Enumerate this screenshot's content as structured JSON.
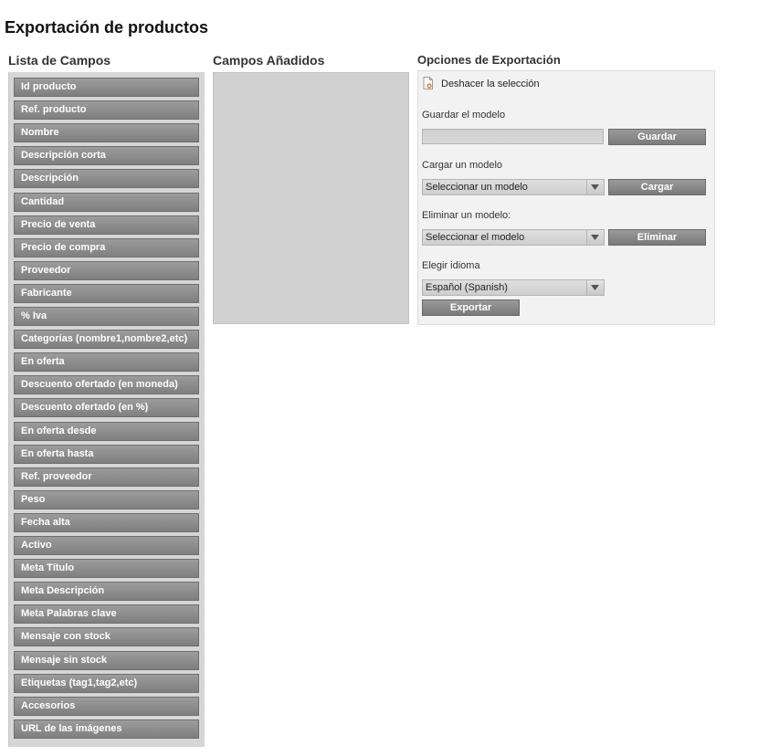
{
  "page": {
    "title": "Exportación de productos"
  },
  "fields": {
    "title": "Lista de Campos",
    "items": [
      "Id producto",
      "Ref. producto",
      "Nombre",
      "Descripción corta",
      "Descripción",
      "Cantidad",
      "Precio de venta",
      "Precio de compra",
      "Proveedor",
      "Fabricante",
      "% Iva",
      "Categorías (nombre1,nombre2,etc)",
      "En oferta",
      "Descuento ofertado (en moneda)",
      "Descuento ofertado (en %)",
      "En oferta desde",
      "En oferta hasta",
      "Ref. proveedor",
      "Peso",
      "Fecha alta",
      "Activo",
      "Meta Título",
      "Meta Descripción",
      "Meta Palabras clave",
      "Mensaje con stock",
      "Mensaje sin stock",
      "Etiquetas (tag1,tag2,etc)",
      "Accesorios",
      "URL de las imágenes"
    ]
  },
  "added": {
    "title": "Campos Añadidos"
  },
  "options": {
    "title": "Opciones de Exportación",
    "undo_label": "Deshacer la selección",
    "save_label": "Guardar el modelo",
    "save_input_value": "",
    "save_button": "Guardar",
    "load_label": "Cargar un modelo",
    "load_select": "Seleccionar un modelo",
    "load_button": "Cargar",
    "delete_label": "Eliminar un modelo:",
    "delete_select": "Seleccionar el modelo",
    "delete_button": "Eliminar",
    "language_label": "Elegir idioma",
    "language_select": "Español (Spanish)",
    "export_button": "Exportar"
  },
  "icons": {
    "undo": "undo-document-icon",
    "dropdown": "chevron-down-icon"
  }
}
